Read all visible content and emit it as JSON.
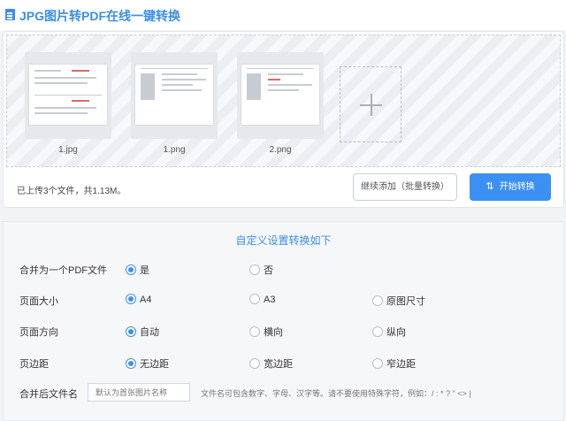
{
  "header": {
    "title": "JPG图片转PDF在线一键转换",
    "icon": "document-icon"
  },
  "upload": {
    "files": [
      {
        "name": "1.jpg"
      },
      {
        "name": "1.png"
      },
      {
        "name": "2.png"
      }
    ],
    "add_icon": "plus-icon",
    "status": "已上传3个文件，共1.13M。",
    "continue_label": "继续添加（批量转换）",
    "start_label": "开始转换",
    "start_icon": "swap-icon"
  },
  "settings": {
    "title": "自定义设置转换如下",
    "merge": {
      "label": "合并为一个PDF文件",
      "options": [
        "是",
        "否"
      ],
      "selected": "是"
    },
    "page_size": {
      "label": "页面大小",
      "options": [
        "A4",
        "A3",
        "原图尺寸"
      ],
      "selected": "A4"
    },
    "orientation": {
      "label": "页面方向",
      "options": [
        "自动",
        "横向",
        "纵向"
      ],
      "selected": "自动"
    },
    "margin": {
      "label": "页边距",
      "options": [
        "无边距",
        "宽边距",
        "窄边距"
      ],
      "selected": "无边距"
    },
    "filename": {
      "label": "合并后文件名",
      "placeholder": "默认为首张图片名称",
      "hint": "文件名可包含数字、字母、汉字等。请不要使用特殊字符，例如：/ : * ? \" <> |"
    }
  },
  "colors": {
    "accent": "#3d90f3",
    "title": "#3b8ee6"
  }
}
